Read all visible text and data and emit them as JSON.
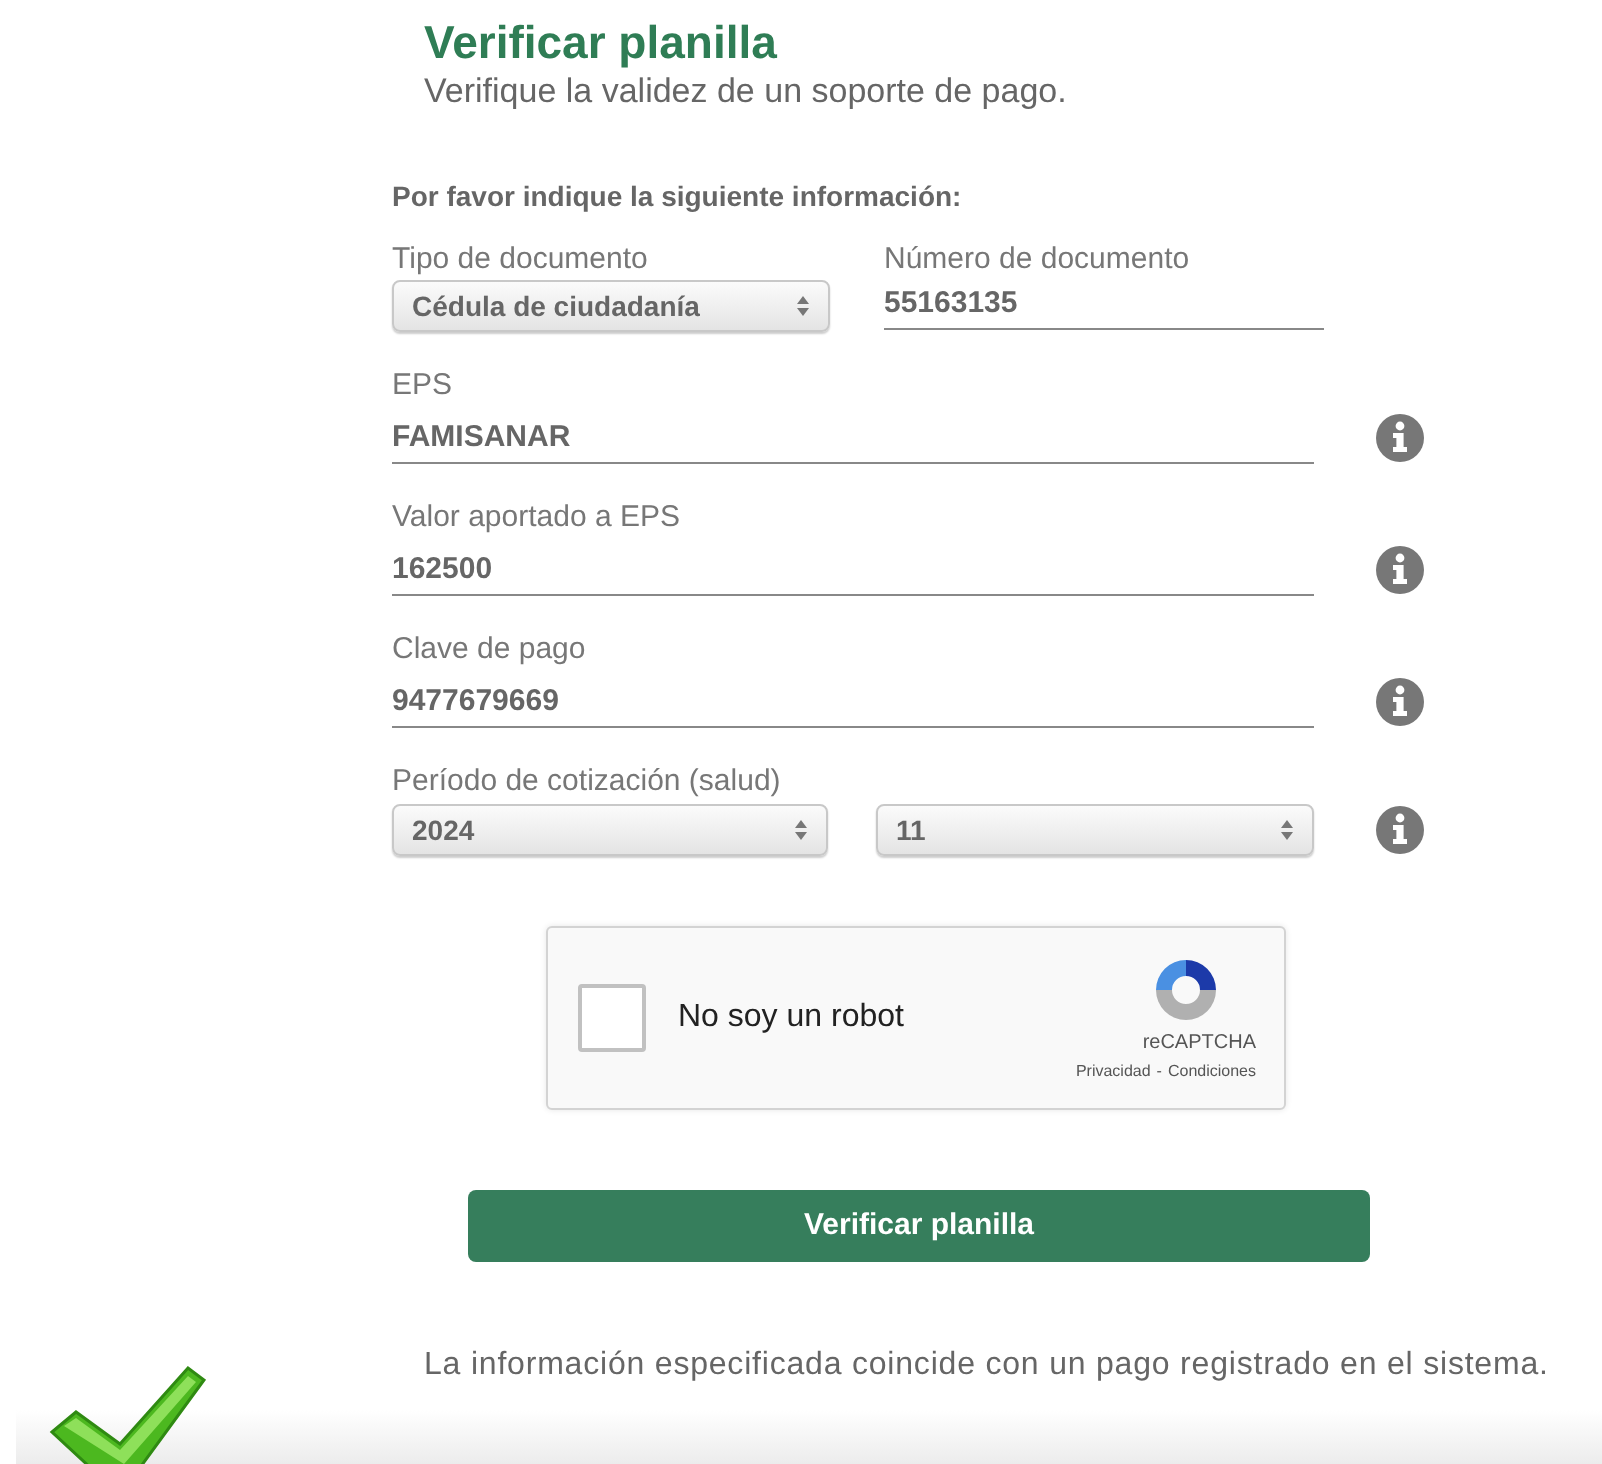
{
  "header": {
    "title": "Verificar planilla",
    "subtitle": "Verifique la validez de un soporte de pago."
  },
  "form": {
    "intro": "Por favor indique la siguiente información:",
    "doc_type": {
      "label": "Tipo de documento",
      "value": "Cédula de ciudadanía"
    },
    "doc_number": {
      "label": "Número de documento",
      "value": "55163135"
    },
    "fields": [
      {
        "kind": "text",
        "label": "EPS",
        "value": "FAMISANAR"
      },
      {
        "kind": "text",
        "label": "Valor aportado a EPS",
        "value": "162500"
      },
      {
        "kind": "text",
        "label": "Clave de pago",
        "value": "9477679669"
      },
      {
        "kind": "selects",
        "label": "Período de cotización (salud)",
        "values": [
          "2024",
          "11"
        ]
      }
    ]
  },
  "captcha": {
    "checked": false,
    "label": "No soy un robot",
    "brand": "reCAPTCHA",
    "links": [
      "Privacidad",
      "Condiciones"
    ],
    "separator": "-"
  },
  "submit": "Verificar planilla",
  "result": {
    "success": true,
    "message": "La información especificada coincide con un pago registrado en el sistema."
  }
}
